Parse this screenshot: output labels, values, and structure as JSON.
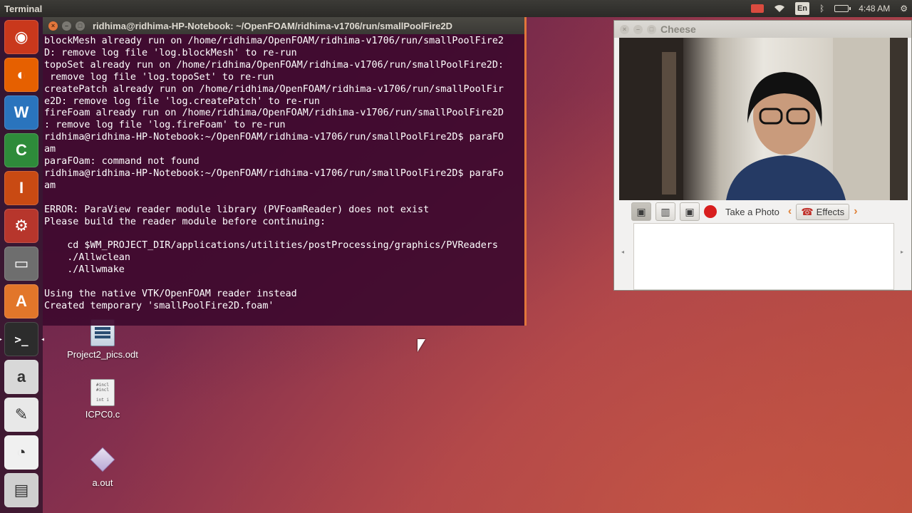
{
  "top_panel": {
    "app_title": "Terminal",
    "lang": "En",
    "time": "4:48 AM",
    "indicators": [
      "camera-indicator",
      "wifi-icon",
      "language-indicator",
      "bluetooth-icon",
      "battery-icon",
      "clock",
      "settings-gear-icon"
    ]
  },
  "launcher": {
    "items": [
      {
        "name": "ubuntu-dash-icon",
        "glyph": "◉",
        "bg": "#c9381c"
      },
      {
        "name": "firefox-icon",
        "glyph": "◐",
        "bg": "#e66000"
      },
      {
        "name": "libreoffice-writer-icon",
        "glyph": "W",
        "bg": "#2a74bd"
      },
      {
        "name": "libreoffice-calc-icon",
        "glyph": "C",
        "bg": "#2e8b3a"
      },
      {
        "name": "libreoffice-impress-icon",
        "glyph": "I",
        "bg": "#c94a13"
      },
      {
        "name": "system-settings-icon",
        "glyph": "⚙",
        "bg": "#b7362c"
      },
      {
        "name": "files-icon",
        "glyph": "▭",
        "bg": "#6e6e6e"
      },
      {
        "name": "software-center-icon",
        "glyph": "A",
        "bg": "#e2762a"
      },
      {
        "name": "terminal-icon",
        "glyph": ">_",
        "bg": "#2c2c2c"
      },
      {
        "name": "amazon-icon",
        "glyph": "a",
        "bg": "#d8d8d8"
      },
      {
        "name": "text-editor-icon",
        "glyph": "✎",
        "bg": "#e8e8e8"
      },
      {
        "name": "document-viewer-icon",
        "glyph": "◔",
        "bg": "#f0f0f0"
      },
      {
        "name": "scanner-icon",
        "glyph": "▤",
        "bg": "#cfcfcf"
      }
    ]
  },
  "terminal": {
    "title": "ridhima@ridhima-HP-Notebook: ~/OpenFOAM/ridhima-v1706/run/smallPoolFire2D",
    "lines": [
      "blockMesh already run on /home/ridhima/OpenFOAM/ridhima-v1706/run/smallPoolFire2",
      "D: remove log file 'log.blockMesh' to re-run",
      "topoSet already run on /home/ridhima/OpenFOAM/ridhima-v1706/run/smallPoolFire2D:",
      " remove log file 'log.topoSet' to re-run",
      "createPatch already run on /home/ridhima/OpenFOAM/ridhima-v1706/run/smallPoolFir",
      "e2D: remove log file 'log.createPatch' to re-run",
      "fireFoam already run on /home/ridhima/OpenFOAM/ridhima-v1706/run/smallPoolFire2D",
      ": remove log file 'log.fireFoam' to re-run",
      "ridhima@ridhima-HP-Notebook:~/OpenFOAM/ridhima-v1706/run/smallPoolFire2D$ paraFO",
      "am",
      "paraFOam: command not found",
      "ridhima@ridhima-HP-Notebook:~/OpenFOAM/ridhima-v1706/run/smallPoolFire2D$ paraFo",
      "am",
      "",
      "ERROR: ParaView reader module library (PVFoamReader) does not exist",
      "Please build the reader module before continuing:",
      "",
      "    cd $WM_PROJECT_DIR/applications/utilities/postProcessing/graphics/PVReaders",
      "    ./Allwclean",
      "    ./Allwmake",
      "",
      "Using the native VTK/OpenFOAM reader instead",
      "Created temporary 'smallPoolFire2D.foam'"
    ]
  },
  "cheese": {
    "title": "Cheese",
    "take_photo": "Take a Photo",
    "effects": "Effects"
  },
  "desktop": {
    "icons": [
      {
        "label": "Project2_pics.odt"
      },
      {
        "label": "ICPC0.c"
      },
      {
        "label": "a.out"
      }
    ]
  },
  "colors": {
    "terminal_bg": "#3e0a2e",
    "accent": "#e2763b",
    "record": "#d81e1e"
  }
}
